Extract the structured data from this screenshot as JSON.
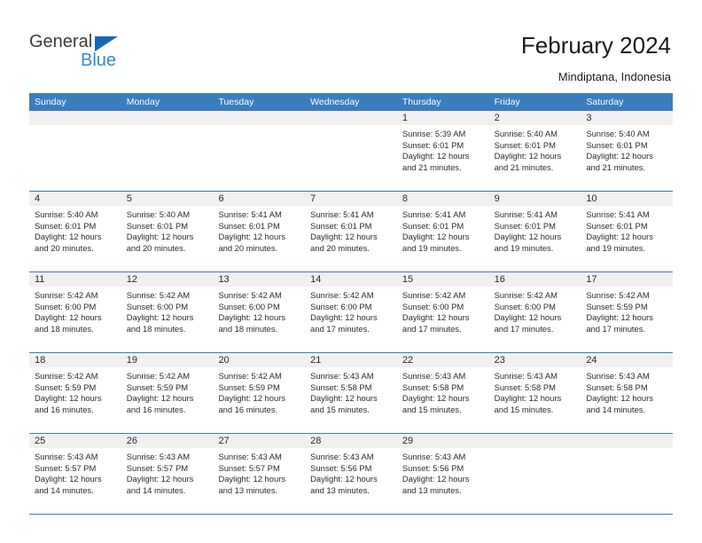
{
  "brand": {
    "name_primary": "General",
    "name_secondary": "Blue"
  },
  "header": {
    "title": "February 2024",
    "location": "Mindiptana, Indonesia"
  },
  "colors": {
    "header_blue": "#3b7dbf",
    "logo_blue": "#2e8bd0",
    "logo_dark": "#3c3c3c",
    "datebar_gray": "#f0f0f0"
  },
  "weekdays": [
    "Sunday",
    "Monday",
    "Tuesday",
    "Wednesday",
    "Thursday",
    "Friday",
    "Saturday"
  ],
  "weeks": [
    [
      {
        "day": "",
        "lines": []
      },
      {
        "day": "",
        "lines": []
      },
      {
        "day": "",
        "lines": []
      },
      {
        "day": "",
        "lines": []
      },
      {
        "day": "1",
        "lines": [
          "Sunrise: 5:39 AM",
          "Sunset: 6:01 PM",
          "Daylight: 12 hours",
          "and 21 minutes."
        ]
      },
      {
        "day": "2",
        "lines": [
          "Sunrise: 5:40 AM",
          "Sunset: 6:01 PM",
          "Daylight: 12 hours",
          "and 21 minutes."
        ]
      },
      {
        "day": "3",
        "lines": [
          "Sunrise: 5:40 AM",
          "Sunset: 6:01 PM",
          "Daylight: 12 hours",
          "and 21 minutes."
        ]
      }
    ],
    [
      {
        "day": "4",
        "lines": [
          "Sunrise: 5:40 AM",
          "Sunset: 6:01 PM",
          "Daylight: 12 hours",
          "and 20 minutes."
        ]
      },
      {
        "day": "5",
        "lines": [
          "Sunrise: 5:40 AM",
          "Sunset: 6:01 PM",
          "Daylight: 12 hours",
          "and 20 minutes."
        ]
      },
      {
        "day": "6",
        "lines": [
          "Sunrise: 5:41 AM",
          "Sunset: 6:01 PM",
          "Daylight: 12 hours",
          "and 20 minutes."
        ]
      },
      {
        "day": "7",
        "lines": [
          "Sunrise: 5:41 AM",
          "Sunset: 6:01 PM",
          "Daylight: 12 hours",
          "and 20 minutes."
        ]
      },
      {
        "day": "8",
        "lines": [
          "Sunrise: 5:41 AM",
          "Sunset: 6:01 PM",
          "Daylight: 12 hours",
          "and 19 minutes."
        ]
      },
      {
        "day": "9",
        "lines": [
          "Sunrise: 5:41 AM",
          "Sunset: 6:01 PM",
          "Daylight: 12 hours",
          "and 19 minutes."
        ]
      },
      {
        "day": "10",
        "lines": [
          "Sunrise: 5:41 AM",
          "Sunset: 6:01 PM",
          "Daylight: 12 hours",
          "and 19 minutes."
        ]
      }
    ],
    [
      {
        "day": "11",
        "lines": [
          "Sunrise: 5:42 AM",
          "Sunset: 6:00 PM",
          "Daylight: 12 hours",
          "and 18 minutes."
        ]
      },
      {
        "day": "12",
        "lines": [
          "Sunrise: 5:42 AM",
          "Sunset: 6:00 PM",
          "Daylight: 12 hours",
          "and 18 minutes."
        ]
      },
      {
        "day": "13",
        "lines": [
          "Sunrise: 5:42 AM",
          "Sunset: 6:00 PM",
          "Daylight: 12 hours",
          "and 18 minutes."
        ]
      },
      {
        "day": "14",
        "lines": [
          "Sunrise: 5:42 AM",
          "Sunset: 6:00 PM",
          "Daylight: 12 hours",
          "and 17 minutes."
        ]
      },
      {
        "day": "15",
        "lines": [
          "Sunrise: 5:42 AM",
          "Sunset: 6:00 PM",
          "Daylight: 12 hours",
          "and 17 minutes."
        ]
      },
      {
        "day": "16",
        "lines": [
          "Sunrise: 5:42 AM",
          "Sunset: 6:00 PM",
          "Daylight: 12 hours",
          "and 17 minutes."
        ]
      },
      {
        "day": "17",
        "lines": [
          "Sunrise: 5:42 AM",
          "Sunset: 5:59 PM",
          "Daylight: 12 hours",
          "and 17 minutes."
        ]
      }
    ],
    [
      {
        "day": "18",
        "lines": [
          "Sunrise: 5:42 AM",
          "Sunset: 5:59 PM",
          "Daylight: 12 hours",
          "and 16 minutes."
        ]
      },
      {
        "day": "19",
        "lines": [
          "Sunrise: 5:42 AM",
          "Sunset: 5:59 PM",
          "Daylight: 12 hours",
          "and 16 minutes."
        ]
      },
      {
        "day": "20",
        "lines": [
          "Sunrise: 5:42 AM",
          "Sunset: 5:59 PM",
          "Daylight: 12 hours",
          "and 16 minutes."
        ]
      },
      {
        "day": "21",
        "lines": [
          "Sunrise: 5:43 AM",
          "Sunset: 5:58 PM",
          "Daylight: 12 hours",
          "and 15 minutes."
        ]
      },
      {
        "day": "22",
        "lines": [
          "Sunrise: 5:43 AM",
          "Sunset: 5:58 PM",
          "Daylight: 12 hours",
          "and 15 minutes."
        ]
      },
      {
        "day": "23",
        "lines": [
          "Sunrise: 5:43 AM",
          "Sunset: 5:58 PM",
          "Daylight: 12 hours",
          "and 15 minutes."
        ]
      },
      {
        "day": "24",
        "lines": [
          "Sunrise: 5:43 AM",
          "Sunset: 5:58 PM",
          "Daylight: 12 hours",
          "and 14 minutes."
        ]
      }
    ],
    [
      {
        "day": "25",
        "lines": [
          "Sunrise: 5:43 AM",
          "Sunset: 5:57 PM",
          "Daylight: 12 hours",
          "and 14 minutes."
        ]
      },
      {
        "day": "26",
        "lines": [
          "Sunrise: 5:43 AM",
          "Sunset: 5:57 PM",
          "Daylight: 12 hours",
          "and 14 minutes."
        ]
      },
      {
        "day": "27",
        "lines": [
          "Sunrise: 5:43 AM",
          "Sunset: 5:57 PM",
          "Daylight: 12 hours",
          "and 13 minutes."
        ]
      },
      {
        "day": "28",
        "lines": [
          "Sunrise: 5:43 AM",
          "Sunset: 5:56 PM",
          "Daylight: 12 hours",
          "and 13 minutes."
        ]
      },
      {
        "day": "29",
        "lines": [
          "Sunrise: 5:43 AM",
          "Sunset: 5:56 PM",
          "Daylight: 12 hours",
          "and 13 minutes."
        ]
      },
      {
        "day": "",
        "lines": []
      },
      {
        "day": "",
        "lines": []
      }
    ]
  ]
}
